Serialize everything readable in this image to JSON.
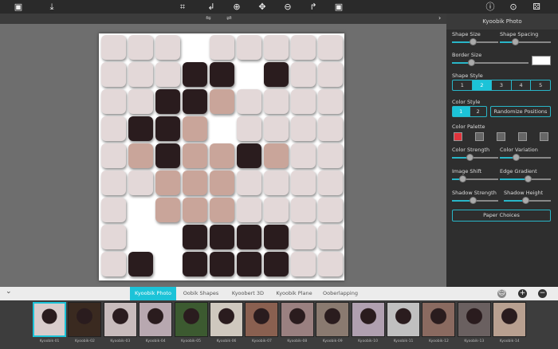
{
  "toolbar": {
    "left": [
      {
        "icon": "open-image-icon",
        "glyph": "▣"
      },
      {
        "icon": "save-icon",
        "glyph": "⤓"
      }
    ],
    "center": [
      {
        "icon": "crop-icon",
        "glyph": "⌗"
      },
      {
        "icon": "undo-icon",
        "glyph": "↲"
      },
      {
        "icon": "zoom-in-icon",
        "glyph": "⊕"
      },
      {
        "icon": "move-icon",
        "glyph": "✥"
      },
      {
        "icon": "zoom-out-icon",
        "glyph": "⊖"
      },
      {
        "icon": "redo-icon",
        "glyph": "↱"
      },
      {
        "icon": "fit-icon",
        "glyph": "▣"
      }
    ],
    "right": [
      {
        "icon": "info-icon",
        "glyph": "ⓘ"
      },
      {
        "icon": "settings-icon",
        "glyph": "⊙"
      },
      {
        "icon": "randomize-icon",
        "glyph": "⚄"
      }
    ]
  },
  "panel": {
    "title": "Kyoobik Photo",
    "collapse_glyph": "›",
    "shape_size": "Shape Size",
    "shape_spacing": "Shape Spacing",
    "border_size": "Border Size",
    "shape_style": "Shape Style",
    "shape_style_options": [
      "1",
      "2",
      "3",
      "4",
      "5"
    ],
    "shape_style_selected": "2",
    "color_style": "Color Style",
    "color_style_options": [
      "1",
      "2"
    ],
    "color_style_selected": "1",
    "randomize": "Randomize Positions",
    "color_palette": "Color Palette",
    "palette": [
      "#e0343c",
      "#666666",
      "#666666",
      "#666666",
      "#666666"
    ],
    "color_strength": "Color Strength",
    "color_variation": "Color Variation",
    "image_shift": "Image Shift",
    "edge_gradient": "Edge Gradient",
    "shadow_strength": "Shadow Strength",
    "shadow_height": "Shadow Height",
    "paper_choices": "Paper Choices",
    "sliders": {
      "shape_size": 0.45,
      "shape_spacing": 0.3,
      "border_size": 0.25,
      "color_strength": 0.38,
      "color_variation": 0.32,
      "image_shift": 0.22,
      "edge_gradient": 0.55,
      "shadow_strength": 0.45,
      "shadow_height": 0.45
    },
    "border_color": "#ffffff",
    "accent": "#1cc3d8"
  },
  "tabs": {
    "items": [
      "Kyoobik Photo",
      "Oobik Shapes",
      "Kyoobert 3D",
      "Kyoobik Plane",
      "Ooberlapping"
    ],
    "selected": "Kyoobik Photo",
    "collapse_glyph": "⌄"
  },
  "thumbnails": [
    "Kyoobik-01",
    "Kyoobik-02",
    "Kyoobik-03",
    "Kyoobik-04",
    "Kyoobik-05",
    "Kyoobik-06",
    "Kyoobik-07",
    "Kyoobik-08",
    "Kyoobik-09",
    "Kyoobik-10",
    "Kyoobik-11",
    "Kyoobik-12",
    "Kyoobik-13",
    "Kyoobik-14"
  ]
}
